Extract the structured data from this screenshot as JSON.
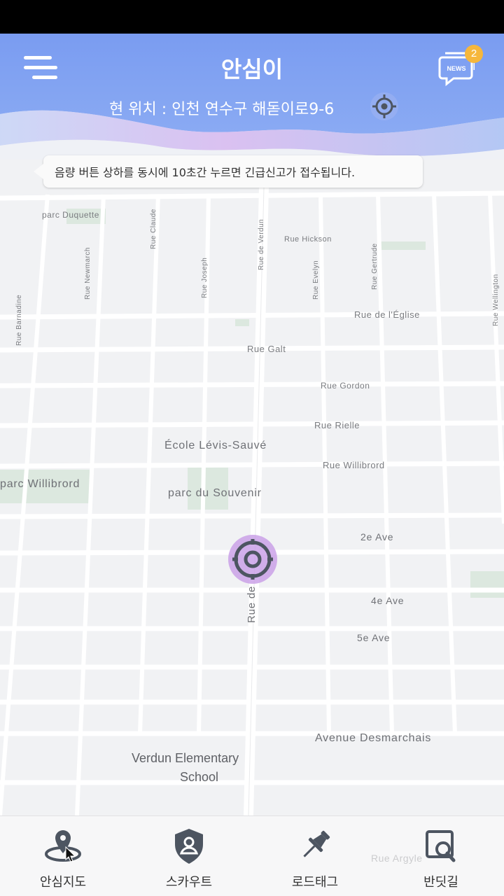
{
  "header": {
    "title": "안심이",
    "location_text": "현 위치 : 인천 연수구 해돋이로9-6",
    "news_badge": "2",
    "news_label": "NEWS"
  },
  "notice": {
    "text": "음량 버튼 상하를 동시에 10초간 누르면 긴급신고가 접수됩니다."
  },
  "map": {
    "labels": {
      "parc_duquette": "parc Duquette",
      "rue_hickson": "Rue Hickson",
      "rue_de_leglise": "Rue de l'Église",
      "rue_galt": "Rue Galt",
      "rue_gordon": "Rue Gordon",
      "rue_rielle": "Rue Rielle",
      "ecole": "École Lévis-Sauvé",
      "rue_willibrord": "Rue Willibrord",
      "parc_willibrord": "parc Willibrord",
      "parc_souvenir": "parc du Souvenir",
      "ave_2e": "2e Ave",
      "ave_4e": "4e Ave",
      "ave_5e": "5e Ave",
      "rue_de": "Rue de",
      "desmarchais": "Avenue Desmarchais",
      "verdun_school_1": "Verdun Elementary",
      "verdun_school_2": "School",
      "rue_barnadine": "Rue Barnadine",
      "rue_newmarch": "Rue Newmarch",
      "rue_claude": "Rue Claude",
      "rue_joseph": "Rue Joseph",
      "rue_de_verdun": "Rue de Verdun",
      "rue_evelyn": "Rue Evelyn",
      "rue_gertrude": "Rue Gertrude",
      "rue_wellington": "Rue Wellington",
      "rue_argyle": "Rue Argyle"
    }
  },
  "nav": {
    "items": [
      {
        "label": "안심지도",
        "icon": "map-pin-icon"
      },
      {
        "label": "스카우트",
        "icon": "shield-user-icon"
      },
      {
        "label": "로드태그",
        "icon": "push-pin-icon"
      },
      {
        "label": "반딧길",
        "icon": "search-frame-icon"
      }
    ]
  },
  "colors": {
    "header_blue": "#7e9ff0",
    "accent_purple": "#c496e6",
    "badge": "#f6b73c",
    "icon_dark": "#4d5561"
  }
}
